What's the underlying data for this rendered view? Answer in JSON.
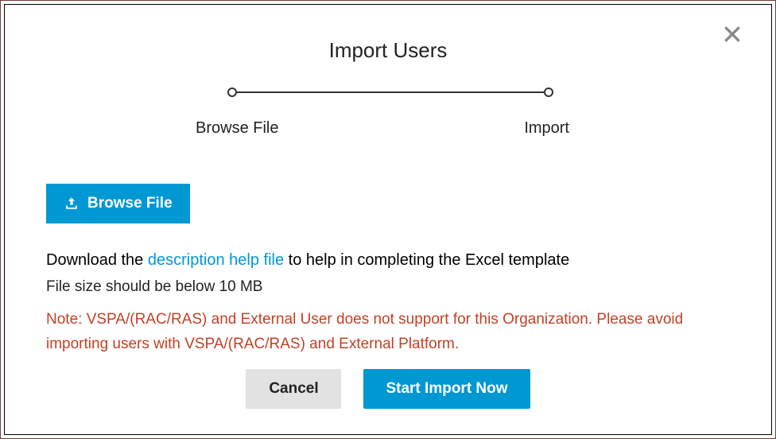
{
  "dialog": {
    "title": "Import Users"
  },
  "stepper": {
    "step1": "Browse File",
    "step2": "Import"
  },
  "browse_button": {
    "label": "Browse File"
  },
  "help": {
    "prefix": "Download the ",
    "link_text": "description help file",
    "suffix": " to help in completing the Excel template"
  },
  "size_hint": "File size should be below 10 MB",
  "note": "Note: VSPA/(RAC/RAS) and External User does not support for this Organization. Please avoid importing users with VSPA/(RAC/RAS) and External Platform.",
  "footer": {
    "cancel": "Cancel",
    "start": "Start Import Now"
  }
}
